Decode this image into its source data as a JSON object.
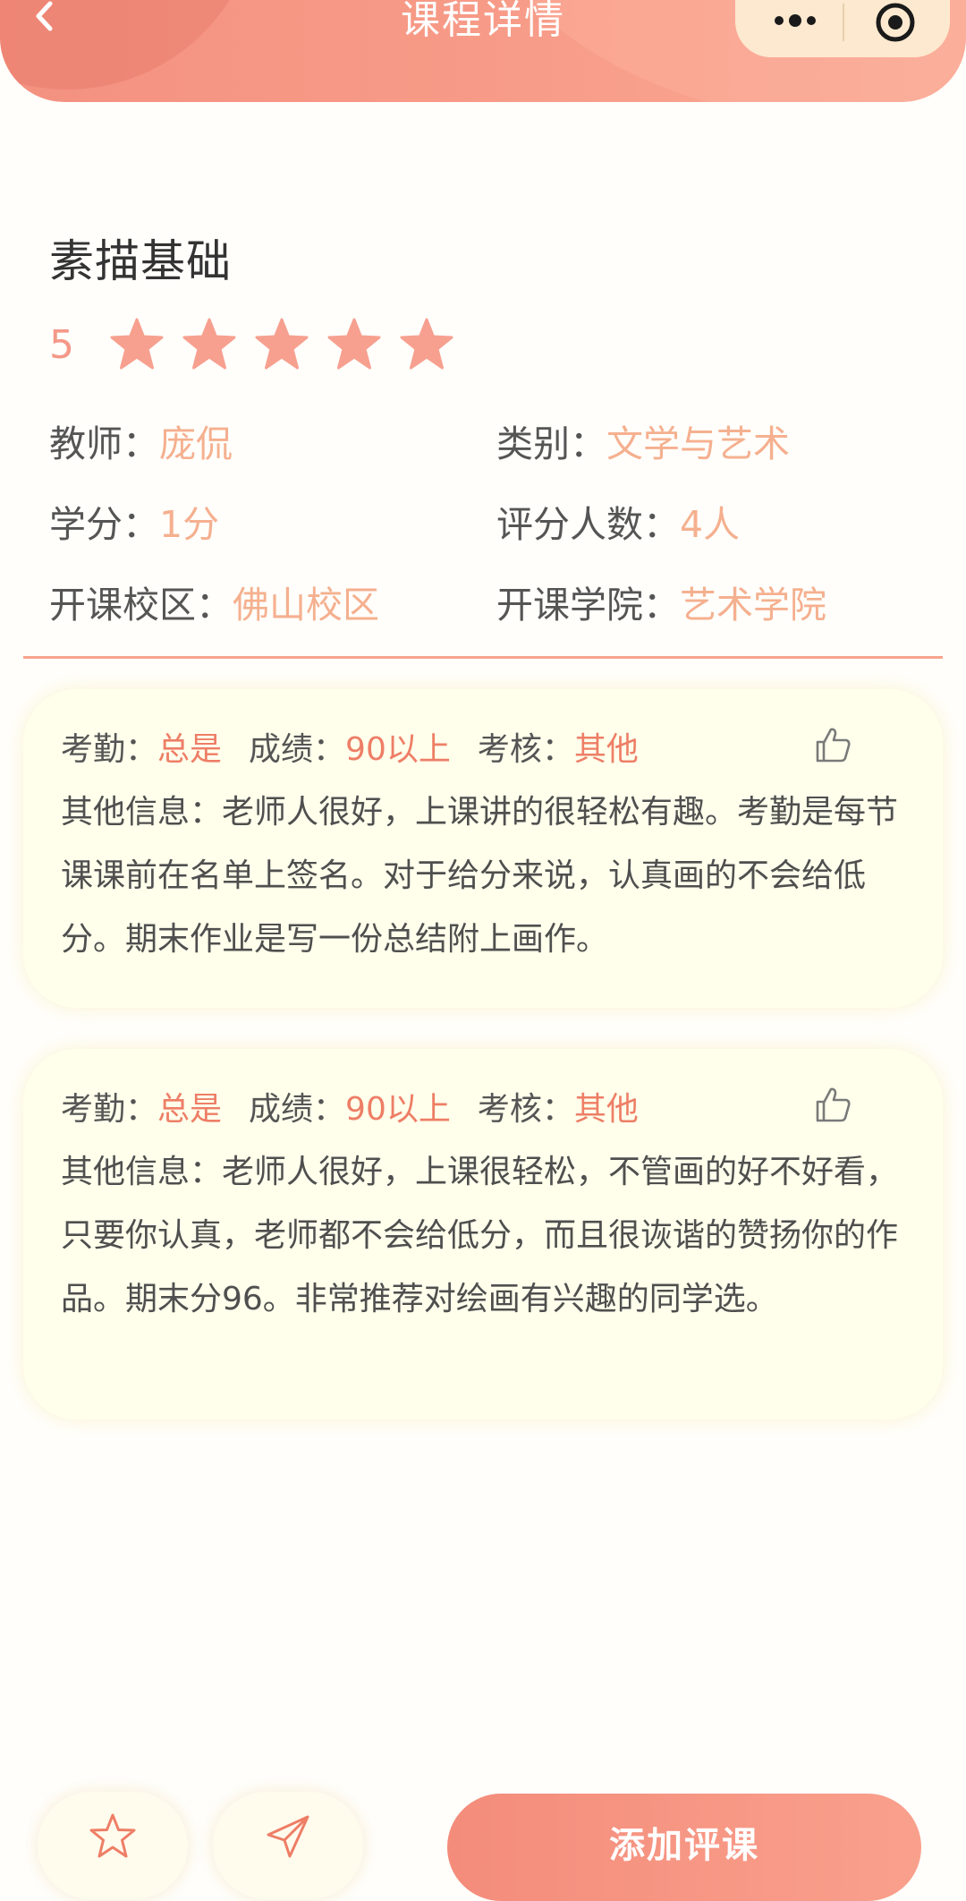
{
  "header": {
    "title": "课程详情",
    "back_icon": "chevron-left-icon",
    "more_icon": "more-dots-icon",
    "close_icon": "target-close-icon",
    "accent_color": "#F79C88"
  },
  "course": {
    "name": "素描基础",
    "rating": "5",
    "rating_stars": 5,
    "star_color": "#F7A08F",
    "info": {
      "teacher_label": "教师：",
      "teacher_value": "庞侃",
      "category_label": "类别：",
      "category_value": "文学与艺术",
      "credit_label": "学分：",
      "credit_value": "1分",
      "raters_label": "评分人数：",
      "raters_value": "4人",
      "campus_label": "开课校区：",
      "campus_value": "佛山校区",
      "college_label": "开课学院：",
      "college_value": "艺术学院"
    }
  },
  "reviews": [
    {
      "attendance_label": "考勤：",
      "attendance_value": "总是",
      "grade_label": "成绩：",
      "grade_value": "90以上",
      "assessment_label": "考核：",
      "assessment_value": "其他",
      "text": "其他信息：老师人很好，上课讲的很轻松有趣。考勤是每节课课前在名单上签名。对于给分来说，认真画的不会给低分。期末作业是写一份总结附上画作。"
    },
    {
      "attendance_label": "考勤：",
      "attendance_value": "总是",
      "grade_label": "成绩：",
      "grade_value": "90以上",
      "assessment_label": "考核：",
      "assessment_value": "其他",
      "text": "其他信息：老师人很好，上课很轻松，不管画的好不好看，只要你认真，老师都不会给低分，而且很诙谐的赞扬你的作品。期末分96。非常推荐对绘画有兴趣的同学选。"
    }
  ],
  "bottom_bar": {
    "favorite_icon": "star-outline-icon",
    "share_icon": "paper-plane-icon",
    "add_review_label": "添加评课",
    "button_color": "#F48C7B"
  }
}
